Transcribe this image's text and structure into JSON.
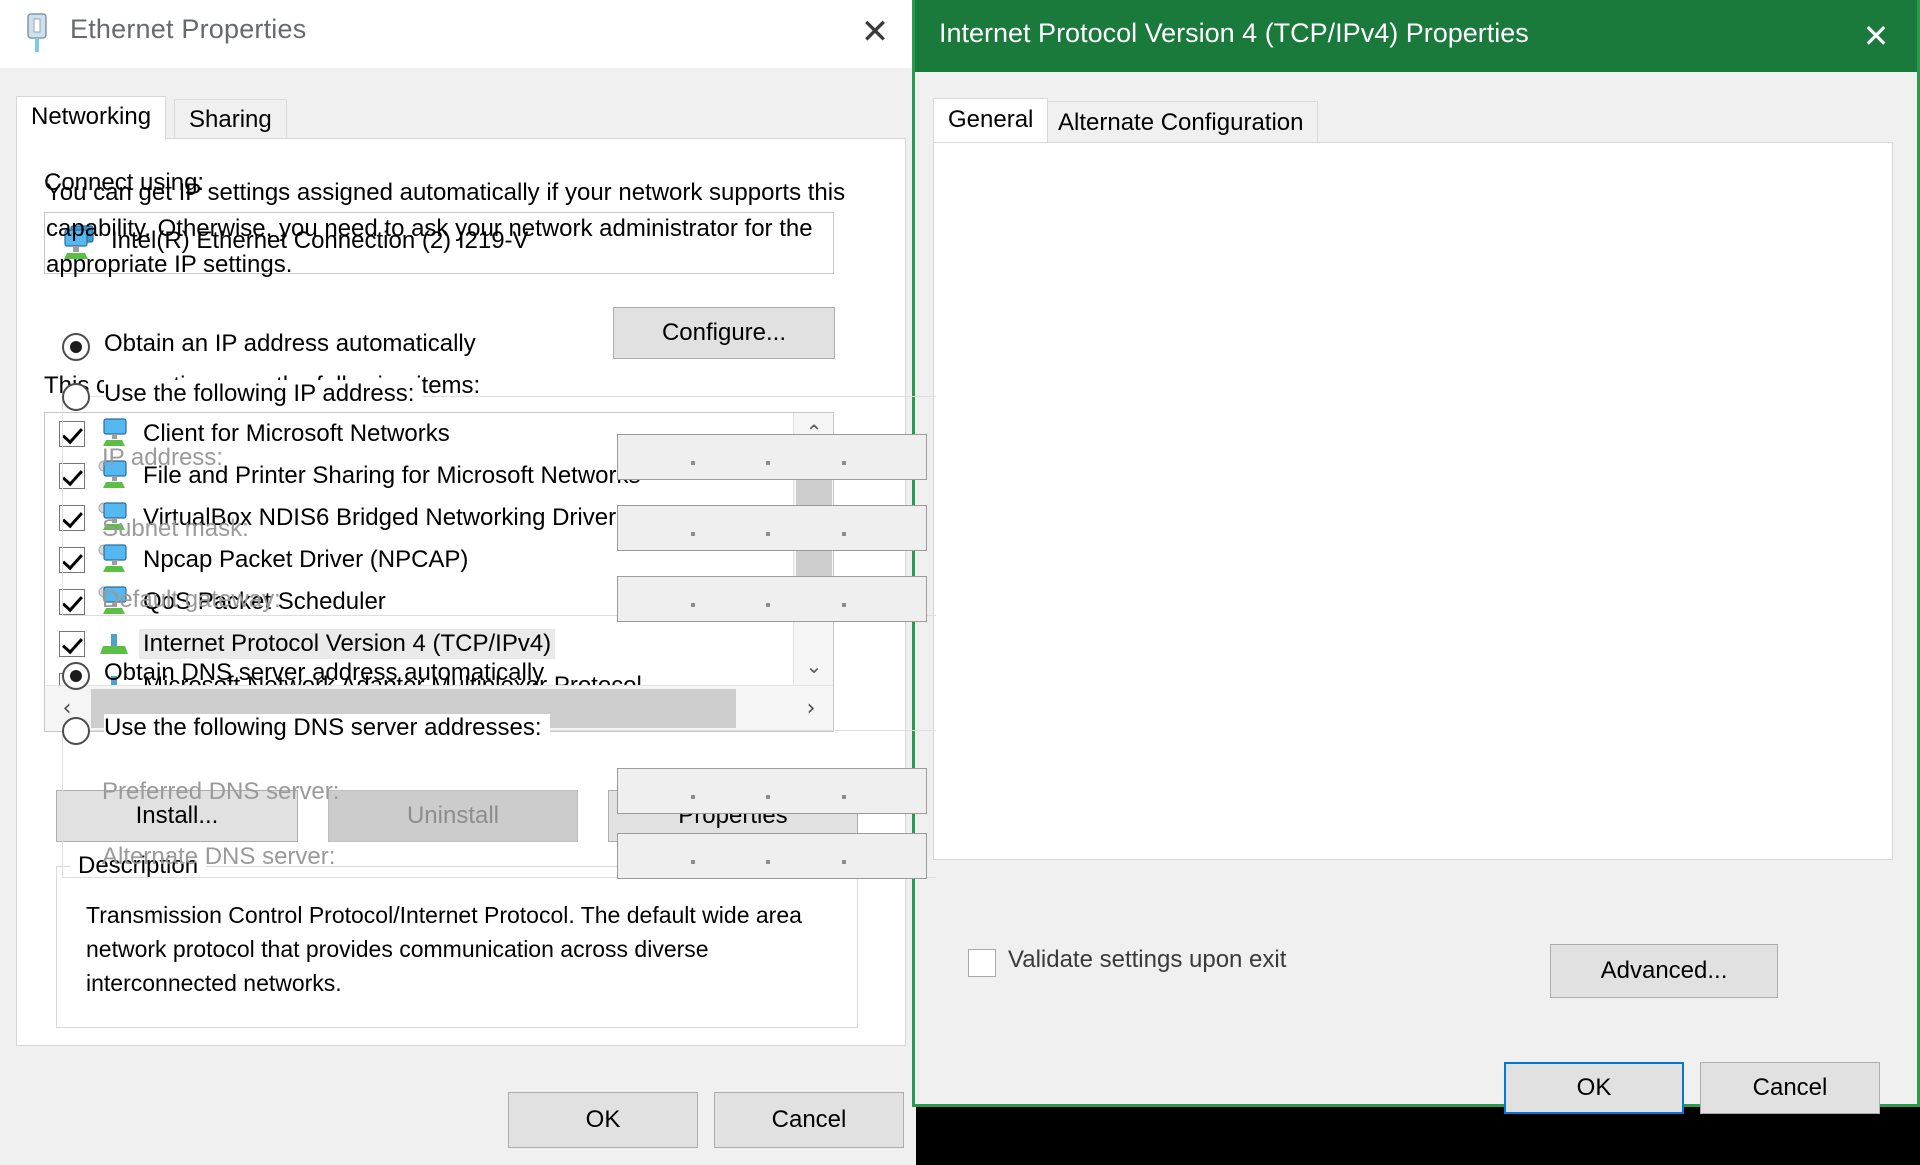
{
  "ethernet_dialog": {
    "title": "Ethernet Properties",
    "title_icon": "ethernet-port-icon",
    "close_icon": "✕",
    "tabs": [
      {
        "label": "Networking",
        "active": true
      },
      {
        "label": "Sharing",
        "active": false
      }
    ],
    "connect_using_label": "Connect using:",
    "adapter": {
      "icon": "network-adapter-icon",
      "name": "Intel(R) Ethernet Connection (2) I219-V"
    },
    "configure_label": "Configure...",
    "items_label": "This connection uses the following items:",
    "items": [
      {
        "label": "Client for Microsoft Networks",
        "checked": true,
        "selected": false,
        "icon": "network-service-icon"
      },
      {
        "label": "File and Printer Sharing for Microsoft Networks",
        "checked": true,
        "selected": false,
        "icon": "network-service-icon"
      },
      {
        "label": "VirtualBox NDIS6 Bridged Networking Driver",
        "checked": true,
        "selected": false,
        "icon": "network-service-icon"
      },
      {
        "label": "Npcap Packet Driver (NPCAP)",
        "checked": true,
        "selected": false,
        "icon": "network-service-icon"
      },
      {
        "label": "QoS Packet Scheduler",
        "checked": true,
        "selected": false,
        "icon": "network-service-icon"
      },
      {
        "label": "Internet Protocol Version 4 (TCP/IPv4)",
        "checked": true,
        "selected": true,
        "icon": "network-protocol-icon"
      },
      {
        "label": "Microsoft Network Adapter Multiplexor Protocol",
        "checked": false,
        "selected": false,
        "icon": "network-protocol-icon"
      }
    ],
    "scroll": {
      "up_arrow": "⌃",
      "down_arrow": "⌄",
      "left_arrow": "‹",
      "right_arrow": "›"
    },
    "install_label": "Install...",
    "uninstall_label": "Uninstall",
    "properties_label": "Properties",
    "description_legend": "Description",
    "description_text": "Transmission Control Protocol/Internet Protocol. The default wide area network protocol that provides communication across diverse interconnected networks.",
    "ok_label": "OK",
    "cancel_label": "Cancel"
  },
  "ipv4_dialog": {
    "title": "Internet Protocol Version 4 (TCP/IPv4) Properties",
    "title_bar_color": "#1a7a3c",
    "border_color": "#2a9a4f",
    "close_icon": "✕",
    "tabs": [
      {
        "label": "General",
        "active": true
      },
      {
        "label": "Alternate Configuration",
        "active": false
      }
    ],
    "intro_text": "You can get IP settings assigned automatically if your network supports this capability. Otherwise, you need to ask your network administrator for the appropriate IP settings.",
    "ip_mode": {
      "auto_label": "Obtain an IP address automatically",
      "auto_selected": true,
      "manual_label": "Use the following IP address:",
      "manual_selected": false
    },
    "ip_fields": [
      {
        "label": "IP address:",
        "value": ""
      },
      {
        "label": "Subnet mask:",
        "value": ""
      },
      {
        "label": "Default gateway:",
        "value": ""
      }
    ],
    "dns_mode": {
      "auto_label": "Obtain DNS server address automatically",
      "auto_selected": true,
      "manual_label": "Use the following DNS server addresses:",
      "manual_selected": false
    },
    "dns_fields": [
      {
        "label": "Preferred DNS server:",
        "value": ""
      },
      {
        "label": "Alternate DNS server:",
        "value": ""
      }
    ],
    "validate_label": "Validate settings upon exit",
    "validate_checked": false,
    "advanced_label": "Advanced...",
    "ok_label": "OK",
    "cancel_label": "Cancel",
    "ok_focus_color": "#0078d7"
  }
}
